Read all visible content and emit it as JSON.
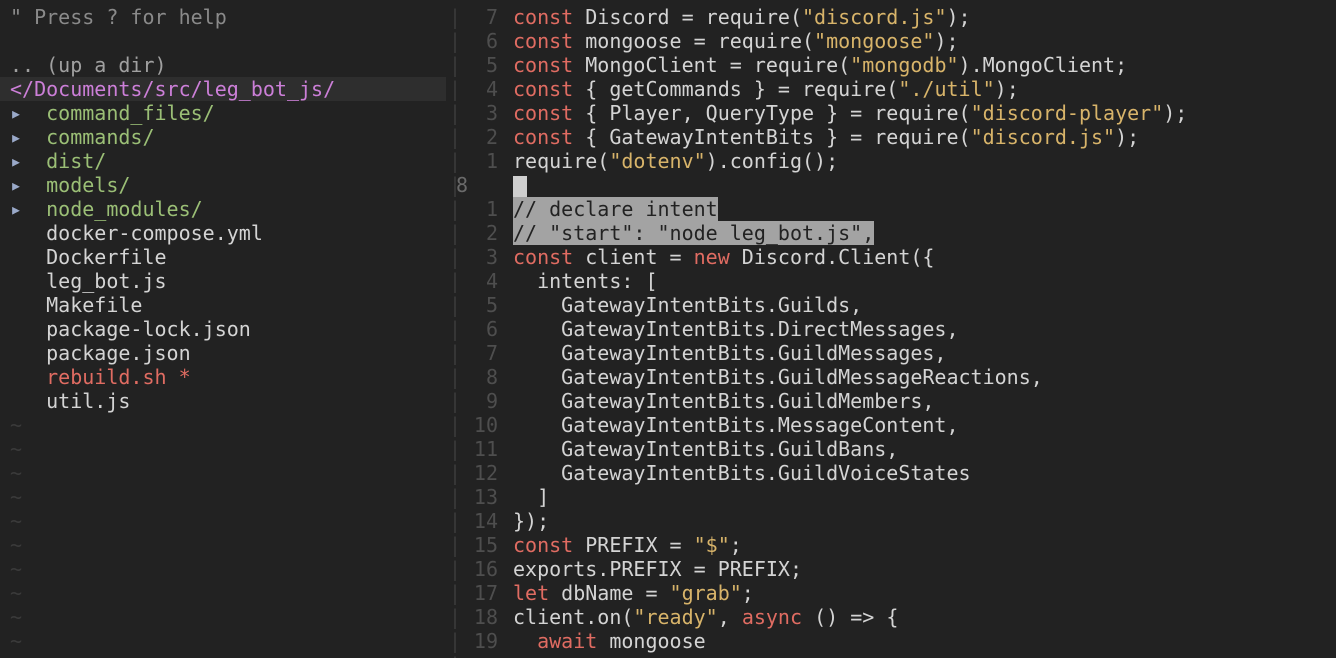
{
  "tree": {
    "help": "\" Press ? for help",
    "up_dir": ".. (up a dir)",
    "root": "</Documents/src/leg_bot_js/",
    "arrow": "▸",
    "modified_marker": "*",
    "tilde": "~",
    "dirs": [
      "command_files/",
      "commands/",
      "dist/",
      "models/",
      "node_modules/"
    ],
    "files": [
      "docker-compose.yml",
      "Dockerfile",
      "leg_bot.js",
      "Makefile",
      "package-lock.json",
      "package.json",
      "rebuild.sh",
      "util.js"
    ],
    "modified_file": "rebuild.sh"
  },
  "editor": {
    "current_line_number": "8",
    "lines": [
      {
        "ln": "7",
        "parts": [
          {
            "t": "kw",
            "v": "const"
          },
          {
            "t": "n",
            "v": " Discord = require("
          },
          {
            "t": "str",
            "v": "\"discord.js\""
          },
          {
            "t": "n",
            "v": ");"
          }
        ]
      },
      {
        "ln": "6",
        "parts": [
          {
            "t": "kw",
            "v": "const"
          },
          {
            "t": "n",
            "v": " mongoose = require("
          },
          {
            "t": "str",
            "v": "\"mongoose\""
          },
          {
            "t": "n",
            "v": ");"
          }
        ]
      },
      {
        "ln": "5",
        "parts": [
          {
            "t": "kw",
            "v": "const"
          },
          {
            "t": "n",
            "v": " MongoClient = require("
          },
          {
            "t": "str",
            "v": "\"mongodb\""
          },
          {
            "t": "n",
            "v": ").MongoClient;"
          }
        ]
      },
      {
        "ln": "4",
        "parts": [
          {
            "t": "kw",
            "v": "const"
          },
          {
            "t": "n",
            "v": " { getCommands } = require("
          },
          {
            "t": "str",
            "v": "\"./util\""
          },
          {
            "t": "n",
            "v": ");"
          }
        ]
      },
      {
        "ln": "3",
        "parts": [
          {
            "t": "kw",
            "v": "const"
          },
          {
            "t": "n",
            "v": " { Player, QueryType } = require("
          },
          {
            "t": "str",
            "v": "\"discord-player\""
          },
          {
            "t": "n",
            "v": ");"
          }
        ]
      },
      {
        "ln": "2",
        "parts": [
          {
            "t": "kw",
            "v": "const"
          },
          {
            "t": "n",
            "v": " { GatewayIntentBits } = require("
          },
          {
            "t": "str",
            "v": "\"discord.js\""
          },
          {
            "t": "n",
            "v": ");"
          }
        ]
      },
      {
        "ln": "1",
        "parts": [
          {
            "t": "n",
            "v": "require("
          },
          {
            "t": "str",
            "v": "\"dotenv\""
          },
          {
            "t": "n",
            "v": ").config();"
          }
        ]
      },
      {
        "ln": "8",
        "current": true,
        "parts": []
      },
      {
        "ln": "1",
        "parts": [
          {
            "t": "sel",
            "v": "// declare intent"
          }
        ]
      },
      {
        "ln": "2",
        "parts": [
          {
            "t": "sel",
            "v": "// \"start\": \"node leg_bot.js\","
          }
        ]
      },
      {
        "ln": "3",
        "parts": [
          {
            "t": "kw",
            "v": "const"
          },
          {
            "t": "n",
            "v": " client = "
          },
          {
            "t": "kw",
            "v": "new"
          },
          {
            "t": "n",
            "v": " Discord.Client({"
          }
        ]
      },
      {
        "ln": "4",
        "parts": [
          {
            "t": "n",
            "v": "  intents: ["
          }
        ]
      },
      {
        "ln": "5",
        "parts": [
          {
            "t": "n",
            "v": "    GatewayIntentBits.Guilds,"
          }
        ]
      },
      {
        "ln": "6",
        "parts": [
          {
            "t": "n",
            "v": "    GatewayIntentBits.DirectMessages,"
          }
        ]
      },
      {
        "ln": "7",
        "parts": [
          {
            "t": "n",
            "v": "    GatewayIntentBits.GuildMessages,"
          }
        ]
      },
      {
        "ln": "8",
        "parts": [
          {
            "t": "n",
            "v": "    GatewayIntentBits.GuildMessageReactions,"
          }
        ]
      },
      {
        "ln": "9",
        "parts": [
          {
            "t": "n",
            "v": "    GatewayIntentBits.GuildMembers,"
          }
        ]
      },
      {
        "ln": "10",
        "parts": [
          {
            "t": "n",
            "v": "    GatewayIntentBits.MessageContent,"
          }
        ]
      },
      {
        "ln": "11",
        "parts": [
          {
            "t": "n",
            "v": "    GatewayIntentBits.GuildBans,"
          }
        ]
      },
      {
        "ln": "12",
        "parts": [
          {
            "t": "n",
            "v": "    GatewayIntentBits.GuildVoiceStates"
          }
        ]
      },
      {
        "ln": "13",
        "parts": [
          {
            "t": "n",
            "v": "  ]"
          }
        ]
      },
      {
        "ln": "14",
        "parts": [
          {
            "t": "n",
            "v": "});"
          }
        ]
      },
      {
        "ln": "15",
        "parts": [
          {
            "t": "kw",
            "v": "const"
          },
          {
            "t": "n",
            "v": " PREFIX = "
          },
          {
            "t": "str",
            "v": "\"$\""
          },
          {
            "t": "n",
            "v": ";"
          }
        ]
      },
      {
        "ln": "16",
        "parts": [
          {
            "t": "n",
            "v": "exports.PREFIX = PREFIX;"
          }
        ]
      },
      {
        "ln": "17",
        "parts": [
          {
            "t": "kw",
            "v": "let"
          },
          {
            "t": "n",
            "v": " dbName = "
          },
          {
            "t": "str",
            "v": "\"grab\""
          },
          {
            "t": "n",
            "v": ";"
          }
        ]
      },
      {
        "ln": "18",
        "parts": [
          {
            "t": "n",
            "v": "client.on("
          },
          {
            "t": "str",
            "v": "\"ready\""
          },
          {
            "t": "n",
            "v": ", "
          },
          {
            "t": "kw",
            "v": "async"
          },
          {
            "t": "n",
            "v": " () => {"
          }
        ]
      },
      {
        "ln": "19",
        "parts": [
          {
            "t": "n",
            "v": "  "
          },
          {
            "t": "kw",
            "v": "await"
          },
          {
            "t": "n",
            "v": " mongoose"
          }
        ]
      }
    ]
  },
  "colors": {
    "background": "#222222",
    "keyword": "#e06c62",
    "string": "#d8b46a",
    "directory": "#9bbf76",
    "root_path": "#cc7fd8",
    "selection": "#a3a3a3"
  }
}
